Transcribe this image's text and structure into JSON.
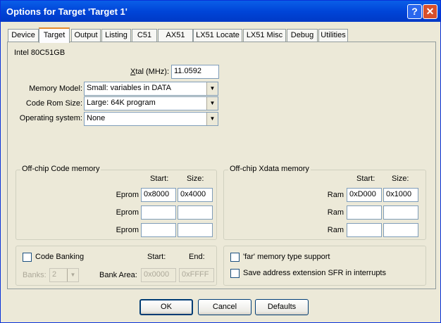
{
  "window": {
    "title": "Options for Target 'Target 1'",
    "help_glyph": "?",
    "close_glyph": "✕"
  },
  "tabs": [
    "Device",
    "Target",
    "Output",
    "Listing",
    "C51",
    "AX51",
    "LX51 Locate",
    "LX51 Misc",
    "Debug",
    "Utilities"
  ],
  "device": "Intel 80C51GB",
  "xtal": {
    "label_x": "X",
    "label_rest": "tal (MHz):",
    "value": "11.0592"
  },
  "memory_model": {
    "label": "Memory Model:",
    "value": "Small: variables in DATA"
  },
  "code_rom_size": {
    "label": "Code Rom Size:",
    "value": "Large: 64K program"
  },
  "operating_system": {
    "label": "Operating system:",
    "value": "None"
  },
  "code_memory": {
    "title": "Off-chip Code memory",
    "start_header": "Start:",
    "size_header": "Size:",
    "rows": [
      {
        "label": "Eprom",
        "start": "0x8000",
        "size": "0x4000"
      },
      {
        "label": "Eprom",
        "start": "",
        "size": ""
      },
      {
        "label": "Eprom",
        "start": "",
        "size": ""
      }
    ]
  },
  "xdata_memory": {
    "title": "Off-chip Xdata memory",
    "start_header": "Start:",
    "size_header": "Size:",
    "rows": [
      {
        "label": "Ram",
        "start": "0xD000",
        "size": "0x1000"
      },
      {
        "label": "Ram",
        "start": "",
        "size": ""
      },
      {
        "label": "Ram",
        "start": "",
        "size": ""
      }
    ]
  },
  "banking": {
    "checkbox_label": "Code Banking",
    "banks_label": "Banks:",
    "banks_value": "2",
    "start_header": "Start:",
    "end_header": "End:",
    "bank_area_label": "Bank Area:",
    "start": "0x0000",
    "end": "0xFFFF"
  },
  "options": {
    "far_label": "'far' memory type support",
    "sfr_label": "Save address extension SFR in interrupts"
  },
  "buttons": {
    "ok": "OK",
    "cancel": "Cancel",
    "defaults": "Defaults"
  }
}
